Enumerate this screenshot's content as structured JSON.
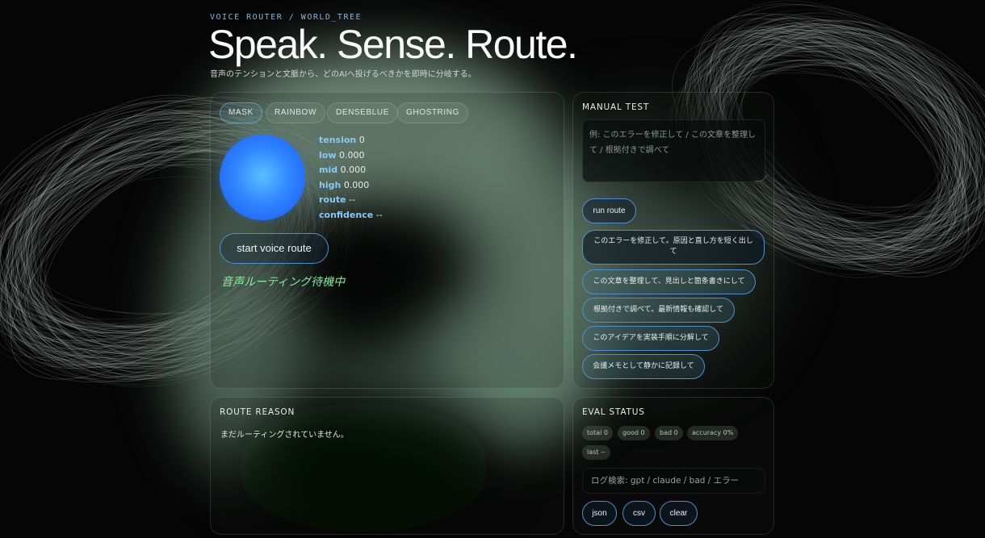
{
  "header": {
    "kicker": "VOICE ROUTER / WORLD_TREE",
    "headline": "Speak. Sense. Route.",
    "subtitle": "音声のテンションと文脈から、どのAIへ投げるべきかを即時に分岐する。"
  },
  "modes": [
    {
      "label": "MASK",
      "active": true
    },
    {
      "label": "RAINBOW",
      "active": false
    },
    {
      "label": "DENSEBLUE",
      "active": false
    },
    {
      "label": "GHOSTRING",
      "active": false
    }
  ],
  "metrics": [
    {
      "key": "tension",
      "value": "0"
    },
    {
      "key": "low",
      "value": "0.000"
    },
    {
      "key": "mid",
      "value": "0.000"
    },
    {
      "key": "high",
      "value": "0.000"
    },
    {
      "key": "route",
      "value": "--"
    },
    {
      "key": "confidence",
      "value": "--"
    }
  ],
  "voice": {
    "button_label": "start voice route",
    "status_text": "音声ルーティング待機中"
  },
  "manual_test": {
    "title": "MANUAL TEST",
    "placeholder": "例: このエラーを修正して / この文章を整理して / 根拠付きで調べて",
    "value": "",
    "run_label": "run route",
    "presets": [
      "このエラーを修正して。原因と直し方を短く出して",
      "この文章を整理して、見出しと箇条書きにして",
      "根拠付きで調べて。最新情報も確認して",
      "このアイデアを実装手順に分解して",
      "会議メモとして静かに記録して"
    ]
  },
  "route_reason": {
    "title": "ROUTE REASON",
    "text": "まだルーティングされていません。"
  },
  "eval_status": {
    "title": "EVAL STATUS",
    "chips": [
      "total 0",
      "good 0",
      "bad 0",
      "accuracy 0%",
      "last --"
    ],
    "search_placeholder": "ログ検索: gpt / claude / bad / エラー",
    "search_value": "",
    "buttons": [
      "json",
      "csv",
      "clear"
    ]
  },
  "colors": {
    "accent": "#4f8fd0",
    "label_blue": "#8cc8f4",
    "status_green": "#86ee9a",
    "orb_blue": "#2f86ff"
  }
}
